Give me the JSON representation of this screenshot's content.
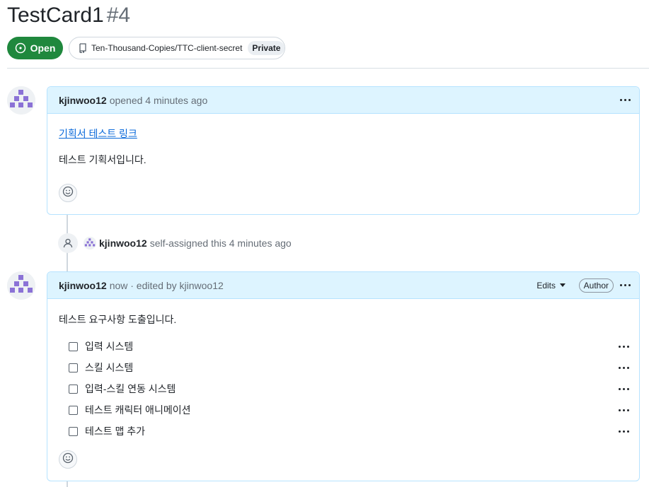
{
  "issue": {
    "title": "TestCard1",
    "number": "#4",
    "state": "Open",
    "repo": "Ten-Thousand-Copies/TTC-client-secret",
    "visibility": "Private"
  },
  "comment1": {
    "author": "kjinwoo12",
    "meta": "opened 4 minutes ago",
    "link_text": "기획서 테스트 링크",
    "text": "테스트 기획서입니다."
  },
  "event": {
    "actor": "kjinwoo12",
    "text": "self-assigned this 4 minutes ago"
  },
  "comment2": {
    "author": "kjinwoo12",
    "meta": "now · edited by kjinwoo12",
    "edits_label": "Edits",
    "author_badge": "Author",
    "intro": "테스트 요구사항 도출입니다.",
    "tasks": [
      {
        "label": "입력 시스템",
        "checked": false
      },
      {
        "label": "스킬 시스템",
        "checked": false
      },
      {
        "label": "입력-스킬 연동 시스템",
        "checked": false
      },
      {
        "label": "테스트 캐릭터 애니메이션",
        "checked": false
      },
      {
        "label": "테스트 맵 추가",
        "checked": false
      }
    ]
  },
  "icons": {
    "state": "issue-opened-icon",
    "repo": "repo-icon",
    "reaction": "smiley-icon",
    "event": "person-icon",
    "menu": "kebab-horizontal-icon",
    "edits": "triangle-down-icon"
  },
  "colors": {
    "open_green": "#1f883d",
    "header_blue": "#ddf4ff",
    "border_blue": "#b6e3ff",
    "avatar_purple": "#8b72d6",
    "link": "#0969da"
  }
}
